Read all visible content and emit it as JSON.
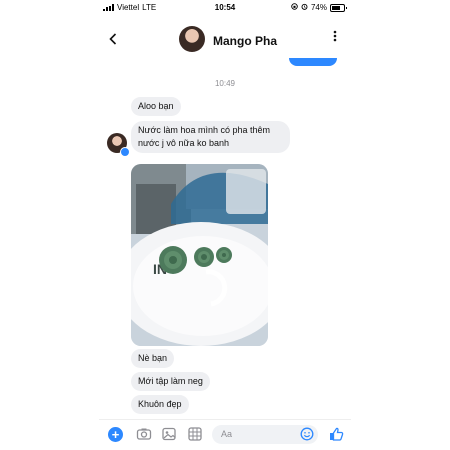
{
  "status_bar": {
    "carrier": "Viettel",
    "network": "LTE",
    "time": "10:54",
    "battery": "74%"
  },
  "header": {
    "back_icon": "chevron-left-icon",
    "contact_name": "Mango Pha",
    "more_icon": "more-vertical-icon"
  },
  "conversation": {
    "timestamp": "10:49",
    "messages_before_photo": [
      "Aloo bạn",
      "Nước làm hoa mình có pha thêm nước j vô nữa ko banh"
    ],
    "photo_description_icon": "photo-attachment",
    "messages_after_photo": [
      "Nè bạn",
      "Mới tập làm neg",
      "Khuôn đẹp"
    ]
  },
  "composer": {
    "placeholder": "Aa",
    "icons": [
      "plus-icon",
      "camera-icon",
      "gallery-icon",
      "grid-icon",
      "emoji-icon",
      "like-icon"
    ]
  },
  "colors": {
    "accent": "#2d88ff",
    "bubble": "#eeeff2"
  }
}
